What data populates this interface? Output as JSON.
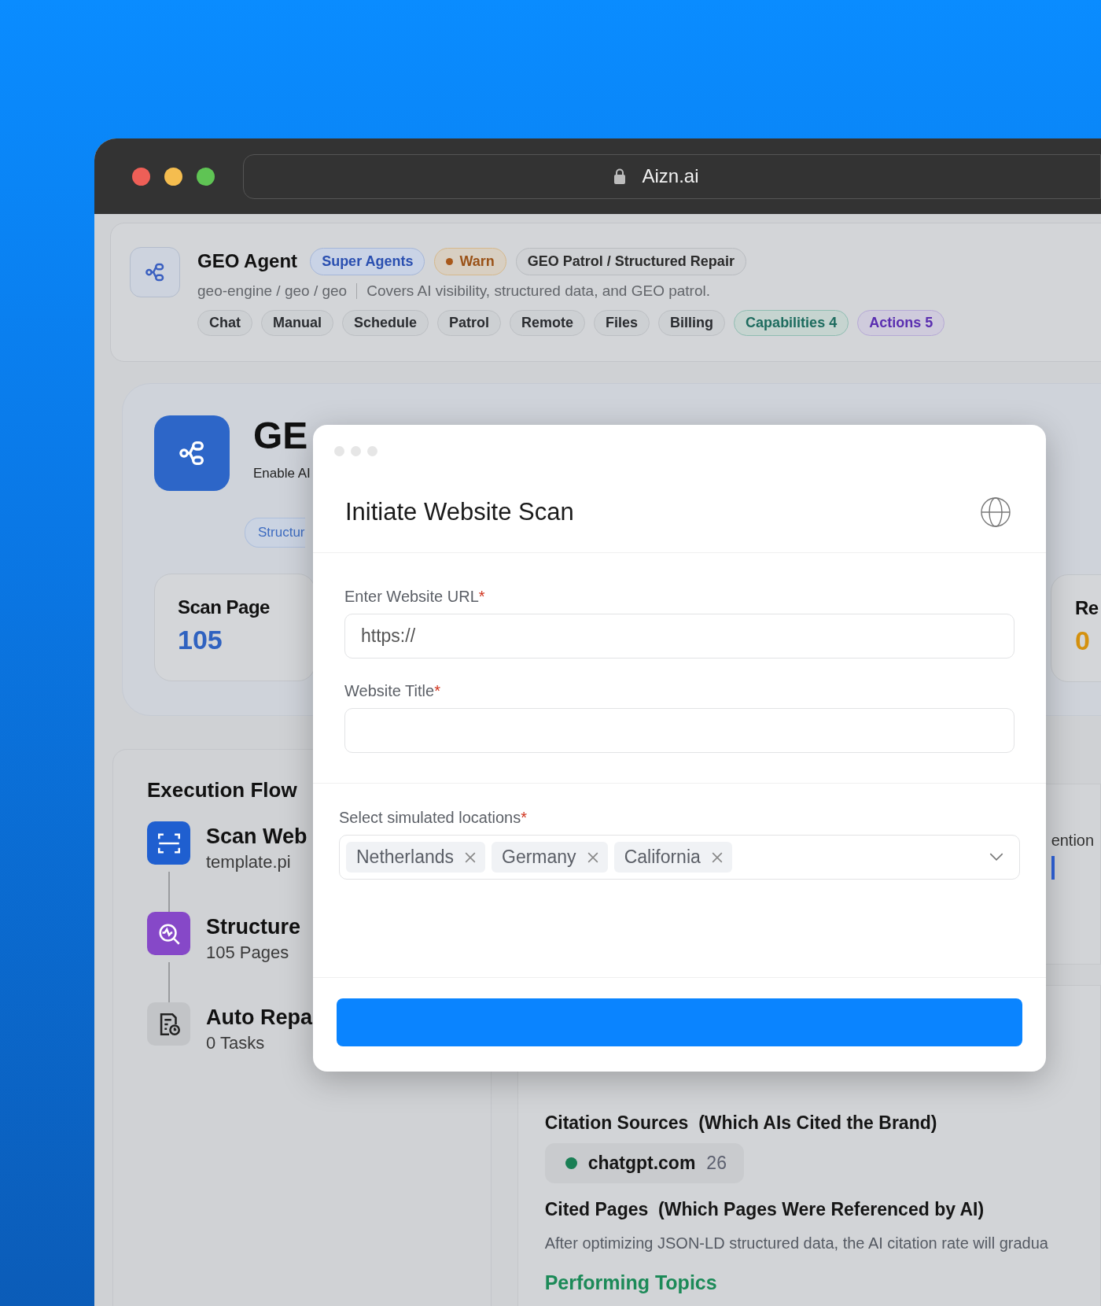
{
  "browser": {
    "address": "Aizn.ai"
  },
  "agent": {
    "name": "GEO Agent",
    "badges": [
      {
        "label": "Super Agents",
        "kind": "blue"
      },
      {
        "label": "Warn",
        "kind": "warn"
      },
      {
        "label": "GEO Patrol / Structured Repair",
        "kind": "plain"
      }
    ],
    "path": "geo-engine / geo / geo",
    "description": "Covers AI visibility, structured data, and GEO patrol.",
    "tabs": [
      {
        "label": "Chat",
        "kind": "plain"
      },
      {
        "label": "Manual",
        "kind": "plain"
      },
      {
        "label": "Schedule",
        "kind": "plain"
      },
      {
        "label": "Patrol",
        "kind": "plain"
      },
      {
        "label": "Remote",
        "kind": "plain"
      },
      {
        "label": "Files",
        "kind": "plain"
      },
      {
        "label": "Billing",
        "kind": "plain"
      },
      {
        "label": "Capabilities 4",
        "kind": "teal"
      },
      {
        "label": "Actions 5",
        "kind": "purple"
      }
    ]
  },
  "hero": {
    "title": "GE",
    "subtitle": "Enable AI",
    "tag": "Structur",
    "stats": [
      {
        "label": "Scan Page",
        "value": "105",
        "kind": "blue"
      },
      {
        "label": "Re",
        "value": "0",
        "kind": "orange"
      }
    ]
  },
  "flow": {
    "title": "Execution Flow",
    "steps": [
      {
        "title": "Scan Web",
        "subtitle": "template.pi",
        "kind": "scan"
      },
      {
        "title": "Structure",
        "subtitle": "105 Pages",
        "kind": "analyze"
      },
      {
        "title": "Auto Repa",
        "subtitle": "0 Tasks",
        "kind": "repair"
      }
    ]
  },
  "mentions": {
    "label": "ention"
  },
  "citations": {
    "title": "Citation Sources",
    "note": "(Which AIs Cited the Brand)",
    "sources": [
      {
        "name": "chatgpt.com",
        "count": "26",
        "color": "#1a7f55"
      }
    ],
    "pages_title": "Cited Pages",
    "pages_note": "(Which Pages Were Referenced by AI)",
    "pages_text": "After optimizing JSON-LD structured data, the AI citation rate will gradua",
    "topics_title": "Performing Topics"
  },
  "modal": {
    "title": "Initiate Website Scan",
    "fields": [
      {
        "label": "Enter Website URL",
        "required_mark": "*",
        "placeholder": "https://"
      },
      {
        "label": "Website Title",
        "required_mark": "*"
      }
    ],
    "locations": {
      "label": "Select simulated locations",
      "required_mark": "*",
      "tags": [
        "Netherlands",
        "Germany",
        "California"
      ]
    }
  }
}
